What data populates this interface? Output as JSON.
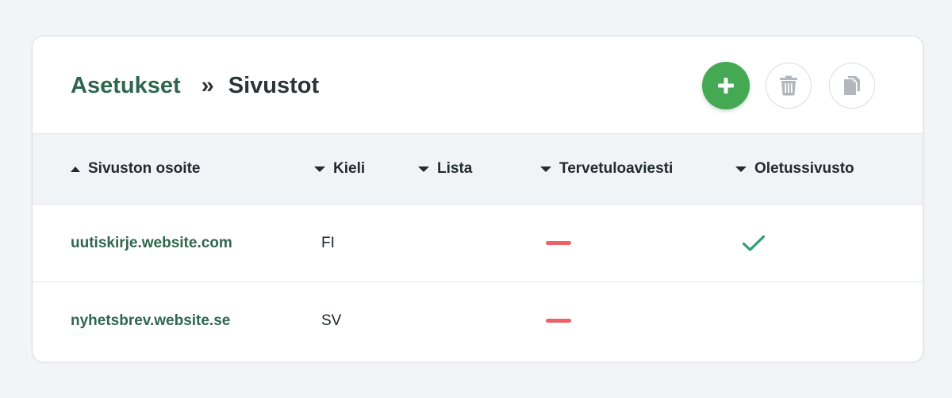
{
  "colors": {
    "brand_green": "#2f6650",
    "add_button_green": "#45a853",
    "dash_red": "#ed6266",
    "check_green": "#2e9e72",
    "header_bg": "#f1f4f7",
    "page_bg": "#f3f4f6"
  },
  "breadcrumb": {
    "parent": "Asetukset",
    "separator": "»",
    "current": "Sivustot"
  },
  "toolbar": {
    "add_icon": "plus-icon",
    "delete_icon": "trash-icon",
    "copy_icon": "copy-icon"
  },
  "table": {
    "columns": [
      {
        "label": "Sivuston osoite",
        "sort": "ascending"
      },
      {
        "label": "Kieli",
        "sort": "descending"
      },
      {
        "label": "Lista",
        "sort": "descending"
      },
      {
        "label": "Tervetuloaviesti",
        "sort": "descending"
      },
      {
        "label": "Oletussivusto",
        "sort": "descending"
      }
    ],
    "rows": [
      {
        "address": "uutiskirje.website.com",
        "language": "FI",
        "list": "",
        "welcome_message": "dash-icon",
        "default_site": "check-icon"
      },
      {
        "address": "nyhetsbrev.website.se",
        "language": "SV",
        "list": "",
        "welcome_message": "dash-icon",
        "default_site": ""
      }
    ]
  }
}
